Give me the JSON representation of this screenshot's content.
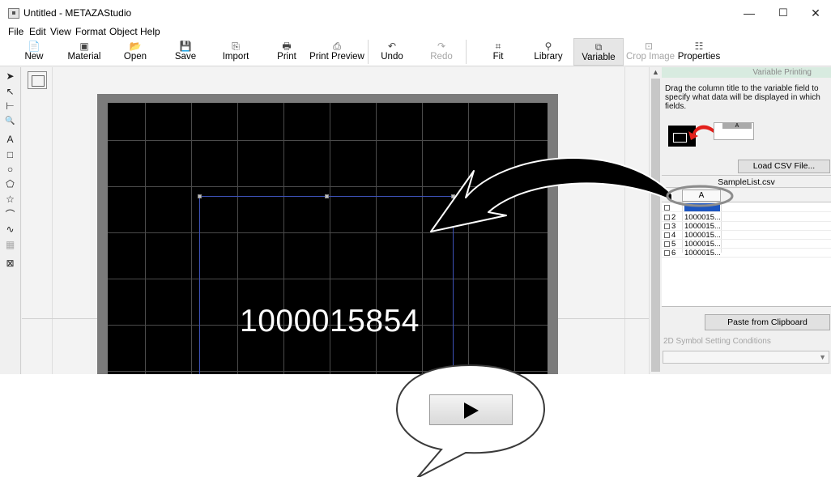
{
  "window": {
    "title": "Untitled - METAZAStudio",
    "minimize": "—",
    "maximize": "☐",
    "close": "✕"
  },
  "menu": [
    "File",
    "Edit",
    "View",
    "Format",
    "Object",
    "Help"
  ],
  "toolbar": {
    "items": [
      {
        "label": "New",
        "icon": "📄"
      },
      {
        "label": "Material",
        "icon": "▣"
      },
      {
        "label": "Open",
        "icon": "📂"
      },
      {
        "label": "Save",
        "icon": "💾"
      },
      {
        "label": "Import",
        "icon": "⎘"
      },
      {
        "label": "Print",
        "icon": "🖶"
      },
      {
        "label": "Print Preview",
        "icon": "⎙"
      },
      {
        "label": "Undo",
        "icon": "↶"
      },
      {
        "label": "Redo",
        "icon": "↷"
      },
      {
        "label": "Fit",
        "icon": "⌗"
      },
      {
        "label": "Library",
        "icon": "⚲"
      },
      {
        "label": "Variable",
        "icon": "⧉"
      },
      {
        "label": "Crop Image",
        "icon": "⊡"
      },
      {
        "label": "Properties",
        "icon": "☷"
      }
    ]
  },
  "tools": [
    "➤",
    "↖",
    "⊢",
    "🔍",
    "A",
    "□",
    "○",
    "⬠",
    "☆",
    "⌒",
    "∿",
    "▦",
    "⊠"
  ],
  "canvas": {
    "text": "1000015854"
  },
  "panel": {
    "header": "Variable Printing",
    "instructions": "Drag the column title to the variable field to specify what data will be displayed in which fields.",
    "illus_column": "A",
    "load_csv": "Load CSV File...",
    "csv_name": "SampleList.csv",
    "column_header": "A",
    "rows": [
      {
        "num": "",
        "value": ""
      },
      {
        "num": "2",
        "value": "1000015..."
      },
      {
        "num": "3",
        "value": "1000015..."
      },
      {
        "num": "4",
        "value": "1000015..."
      },
      {
        "num": "5",
        "value": "1000015..."
      },
      {
        "num": "6",
        "value": "1000015..."
      }
    ],
    "paste": "Paste from Clipboard",
    "symbol_label": "2D Symbol Setting Conditions"
  },
  "colors": {
    "canvas_black": "#000000",
    "selection_blue": "#3d52b8",
    "row_highlight": "#1e56c0",
    "panel_header_bg": "#d8ebe0",
    "arrow_fill": "#000000"
  }
}
